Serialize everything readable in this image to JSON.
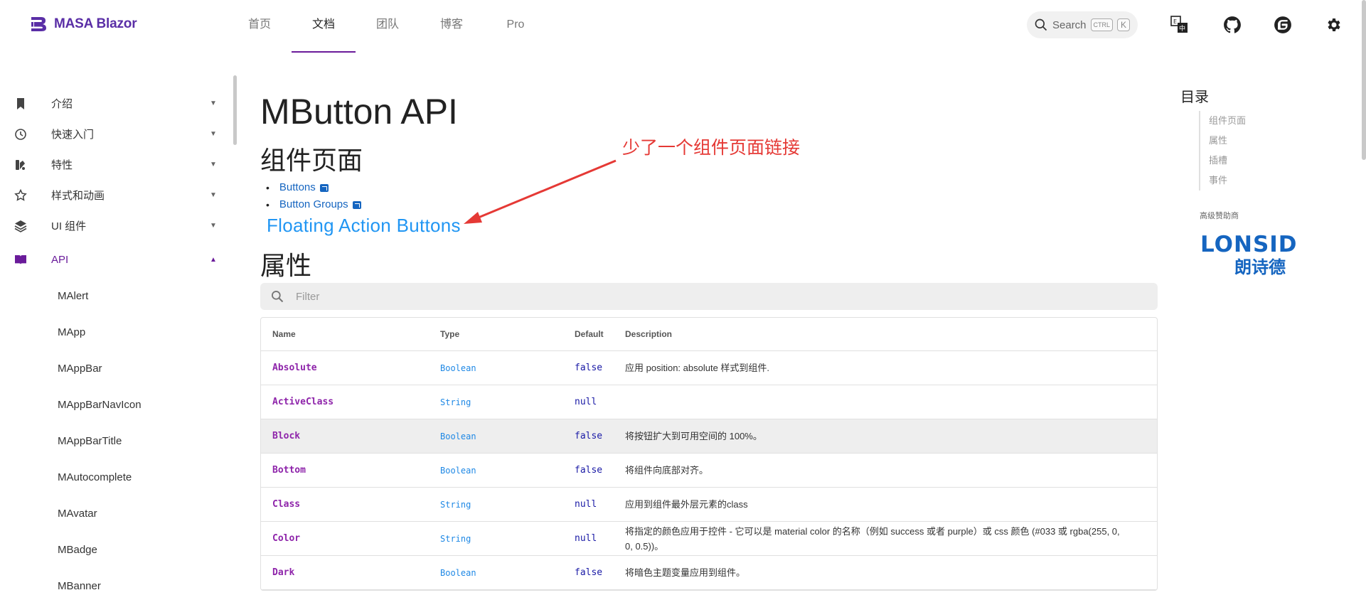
{
  "header": {
    "logo_text": "MASA Blazor",
    "nav": [
      {
        "label": "首页"
      },
      {
        "label": "文档"
      },
      {
        "label": "团队"
      },
      {
        "label": "博客"
      },
      {
        "label": "Pro"
      }
    ],
    "search": {
      "label": "Search",
      "kbd1": "CTRL",
      "kbd2": "K"
    },
    "icons": [
      "translate-icon",
      "github-icon",
      "gitee-icon",
      "settings-icon"
    ]
  },
  "sidebar": {
    "items": [
      {
        "label": "介绍",
        "icon": "bookmark-icon"
      },
      {
        "label": "快速入门",
        "icon": "clock-icon"
      },
      {
        "label": "特性",
        "icon": "palette-icon"
      },
      {
        "label": "样式和动画",
        "icon": "star-icon"
      },
      {
        "label": "UI 组件",
        "icon": "layers-icon"
      },
      {
        "label": "API",
        "icon": "book-icon"
      }
    ],
    "api_items": [
      "MAlert",
      "MApp",
      "MAppBar",
      "MAppBarNavIcon",
      "MAppBarTitle",
      "MAutocomplete",
      "MAvatar",
      "MBadge",
      "MBanner"
    ]
  },
  "main": {
    "title": "MButton API",
    "section_pages": "组件页面",
    "links": [
      "Buttons",
      "Button Groups"
    ],
    "fab_link": "Floating Action Buttons",
    "annotation": "少了一个组件页面链接",
    "section_props": "属性",
    "filter_placeholder": "Filter",
    "table": {
      "headers": [
        "Name",
        "Type",
        "Default",
        "Description"
      ],
      "rows": [
        {
          "name": "Absolute",
          "type": "Boolean",
          "default": "false",
          "desc": "应用 position: absolute 样式到组件."
        },
        {
          "name": "ActiveClass",
          "type": "String",
          "default": "null",
          "desc": ""
        },
        {
          "name": "Block",
          "type": "Boolean",
          "default": "false",
          "desc": "将按钮扩大到可用空间的 100%。"
        },
        {
          "name": "Bottom",
          "type": "Boolean",
          "default": "false",
          "desc": "将组件向底部对齐。"
        },
        {
          "name": "Class",
          "type": "String",
          "default": "null",
          "desc": "应用到组件最外层元素的class"
        },
        {
          "name": "Color",
          "type": "String",
          "default": "null",
          "desc": "将指定的颜色应用于控件 - 它可以是 material color 的名称（例如 success 或者 purple）或 css 颜色 (#033 或 rgba(255, 0, 0, 0.5))。"
        },
        {
          "name": "Dark",
          "type": "Boolean",
          "default": "false",
          "desc": "将暗色主题变量应用到组件。"
        }
      ]
    }
  },
  "toc": {
    "title": "目录",
    "items": [
      "组件页面",
      "属性",
      "插槽",
      "事件"
    ],
    "sponsor_label": "高级赞助商",
    "sponsor_name": "LONSID",
    "sponsor_cn": "朗诗德"
  },
  "colors": {
    "brand": "#5a2ea6",
    "active": "#6a1b9a",
    "link": "#1565c0",
    "annotation": "#e53935",
    "sponsor": "#1565c0"
  }
}
